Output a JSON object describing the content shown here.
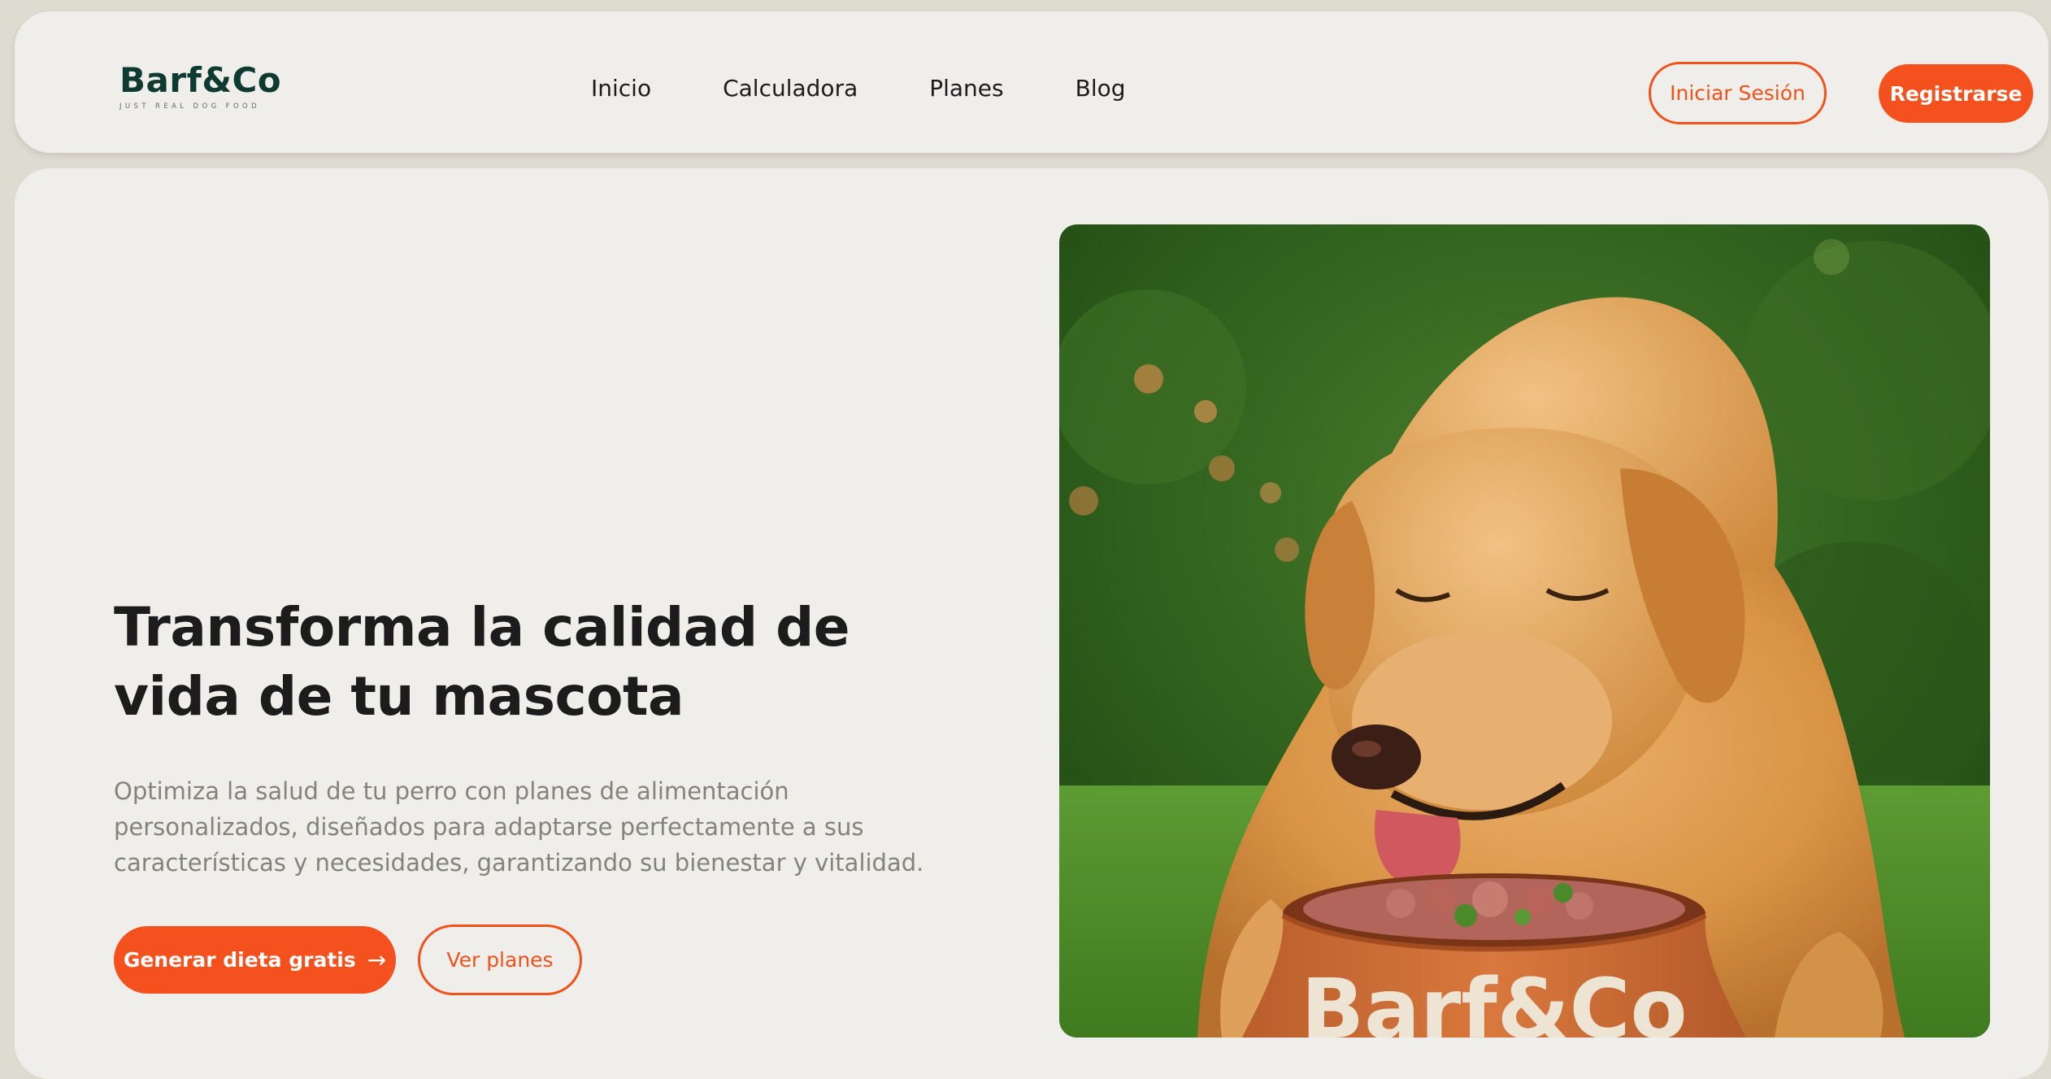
{
  "header": {
    "logo": {
      "name": "Barf&Co",
      "tagline": "JUST REAL DOG FOOD"
    },
    "nav": [
      {
        "label": "Inicio"
      },
      {
        "label": "Calculadora"
      },
      {
        "label": "Planes"
      },
      {
        "label": "Blog"
      }
    ],
    "login_label": "Iniciar Sesión",
    "register_label": "Registrarse"
  },
  "hero": {
    "title_line1": "Transforma la calidad de",
    "title_line2": "vida de tu mascota",
    "subtitle": "Optimiza la salud de tu perro con planes de alimentación personalizados, diseñados para adaptarse perfectamente a sus características y necesidades, garantizando su bienestar y vitalidad.",
    "primary_cta": "Generar dieta gratis",
    "primary_cta_icon": "arrow-right-icon",
    "secondary_cta": "Ver planes",
    "image": {
      "bowl_text": "Barf&Co"
    }
  },
  "colors": {
    "accent": "#f4511e",
    "brand_dark": "#0f3a32",
    "background": "#dedbd1",
    "surface": "#f0eeea",
    "text_primary": "#1c1c1c",
    "text_secondary": "#85827d"
  }
}
